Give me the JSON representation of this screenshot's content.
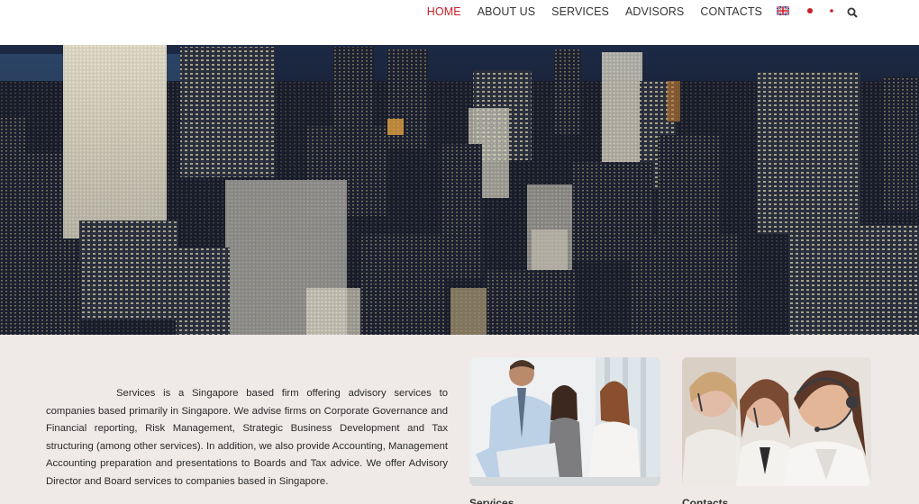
{
  "nav": {
    "items": [
      {
        "label": "HOME",
        "active": true
      },
      {
        "label": "ABOUT US",
        "active": false
      },
      {
        "label": "SERVICES",
        "active": false
      },
      {
        "label": "ADVISORS",
        "active": false
      },
      {
        "label": "CONTACTS",
        "active": false
      }
    ],
    "languages": [
      "uk-flag-icon",
      "japan-flag-icon",
      "japan-flag-icon"
    ],
    "search_icon": "search-icon",
    "active_color": "#c8202a"
  },
  "intro": {
    "text": "Services is a Singapore based firm offering advisory services to companies based primarily in Singapore. We advise firms on Corporate Governance and Financial reporting, Risk Management, Strategic Business Development and Tax structuring (among other services). In addition, we also provide Accounting, Management Accounting preparation and presentations to Boards and Tax advice. We offer Advisory Director and Board services to companies based in Singapore."
  },
  "cards": [
    {
      "caption": "Services"
    },
    {
      "caption": "Contacts"
    }
  ]
}
